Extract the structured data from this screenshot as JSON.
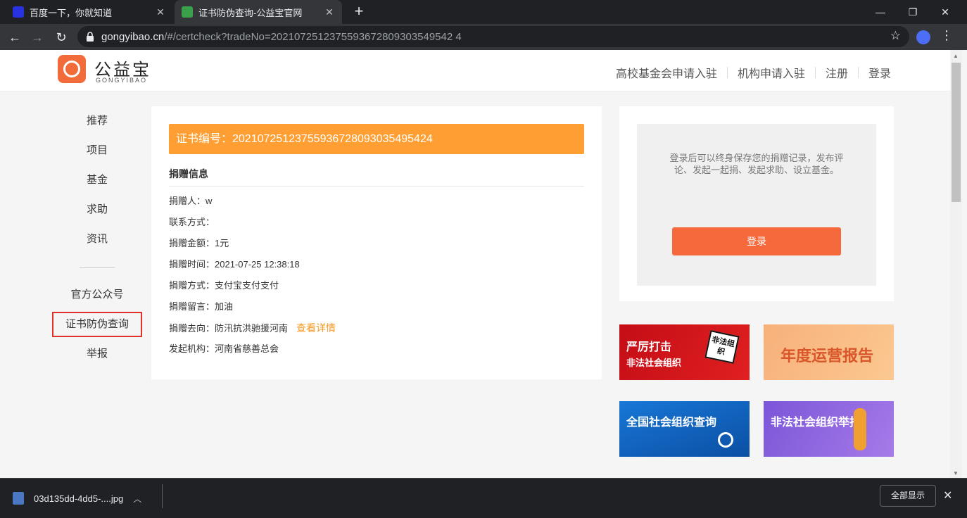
{
  "tabs": [
    {
      "title": "百度一下，你就知道",
      "icon": "baidu-icon"
    },
    {
      "title": "证书防伪查询-公益宝官网",
      "icon": "gongyibao-icon"
    }
  ],
  "url": {
    "host": "gongyibao.cn",
    "path": "/#/certcheck?tradeNo=2021072512375593672809303549542 4"
  },
  "header": {
    "logo_text": "公益宝",
    "logo_sub": "GONGYIBAO",
    "nav": [
      "高校基金会申请入驻",
      "机构申请入驻",
      "注册",
      "登录"
    ]
  },
  "sidebar": {
    "items": [
      "推荐",
      "项目",
      "基金",
      "求助",
      "资讯"
    ],
    "items2": [
      "官方公众号",
      "证书防伪查询",
      "举报"
    ]
  },
  "cert": {
    "label": "证书编号：20210725123755936728093035495424",
    "section_title": "捐赠信息",
    "rows": [
      "捐赠人：w",
      "联系方式：",
      "捐赠金额：1元",
      "捐赠时间：2021-07-25 12:38:18",
      "捐赠方式：支付宝支付支付",
      "捐赠留言：加油",
      "捐赠去向：防汛抗洪驰援河南",
      "发起机构：河南省慈善总会"
    ],
    "detail_link": "查看详情"
  },
  "login_card": {
    "text": "登录后可以终身保存您的捐赠记录，发布评论、发起一起捐、发起求助、设立基金。",
    "button": "登录"
  },
  "banners": [
    {
      "line1": "严厉打击",
      "line2": "非法社会组织",
      "badge": "非法组织"
    },
    {
      "line1": "年度运营报告"
    },
    {
      "line1": "全国社会组织查询"
    },
    {
      "line1": "非法社会组织举报"
    }
  ],
  "download": {
    "filename": "03d135dd-4dd5-....jpg",
    "show_all": "全部显示"
  },
  "colors": {
    "accent": "#ff9f33",
    "login_button": "#f5693d",
    "highlight_border": "#e0312b",
    "link": "#f59a23"
  }
}
